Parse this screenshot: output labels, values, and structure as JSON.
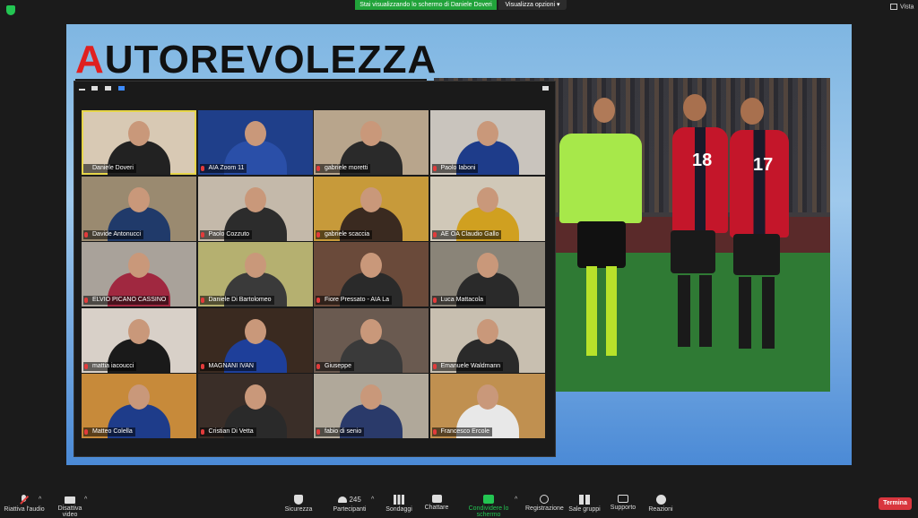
{
  "topbar": {
    "share_banner": "Stai visualizzando lo schermo di Daniele Doveri",
    "view_options": "Visualizza opzioni",
    "view_options_icon": "chevron-down-icon",
    "vista": "Vista"
  },
  "slide": {
    "title_first": "A",
    "title_rest": "UTOREVOLEZZA"
  },
  "photo": {
    "jersey_1": "18",
    "jersey_2": "17"
  },
  "participants": [
    {
      "name": "Daniele Doveri",
      "active": true,
      "muted": false
    },
    {
      "name": "AIA Zoom 11",
      "active": false,
      "muted": true
    },
    {
      "name": "gabriele moretti",
      "active": false,
      "muted": true
    },
    {
      "name": "Paolo Iaboni",
      "active": false,
      "muted": true
    },
    {
      "name": "Davide Antonucci",
      "active": false,
      "muted": true
    },
    {
      "name": "Paolo Cozzuto",
      "active": false,
      "muted": true
    },
    {
      "name": "gabriele scaccia",
      "active": false,
      "muted": true
    },
    {
      "name": "AE OA Claudio Gallo",
      "active": false,
      "muted": true
    },
    {
      "name": "ELVIO PICANO CASSINO",
      "active": false,
      "muted": true
    },
    {
      "name": "Daniele Di Bartolomeo",
      "active": false,
      "muted": true
    },
    {
      "name": "Fiore Pressato - AIA La",
      "active": false,
      "muted": true
    },
    {
      "name": "Luca Mattacola",
      "active": false,
      "muted": true
    },
    {
      "name": "mattia iacoucci",
      "active": false,
      "muted": true
    },
    {
      "name": "MAGNANI IVAN",
      "active": false,
      "muted": true
    },
    {
      "name": "Giuseppe",
      "active": false,
      "muted": true
    },
    {
      "name": "Emanuele Waldmann",
      "active": false,
      "muted": true
    },
    {
      "name": "Matteo Colella",
      "active": false,
      "muted": true
    },
    {
      "name": "Cristian Di Vetta",
      "active": false,
      "muted": true
    },
    {
      "name": "fabio di senio",
      "active": false,
      "muted": true
    },
    {
      "name": "Francesco Ercole",
      "active": false,
      "muted": true
    }
  ],
  "toolbar": {
    "audio": "Riattiva l'audio",
    "video": "Disattiva video",
    "security": "Sicurezza",
    "participants": "Partecipanti",
    "participants_count": "245",
    "polls": "Sondaggi",
    "chat": "Chattare",
    "share": "Condividere lo schermo",
    "record": "Registrazione",
    "breakout": "Sale gruppi",
    "support": "Supporto",
    "reactions": "Reazioni",
    "end": "Termina"
  },
  "colors": {
    "share_green": "#21a33a",
    "end_red": "#d9363e",
    "title_red": "#e02020",
    "active_speaker": "#e6d54a"
  }
}
